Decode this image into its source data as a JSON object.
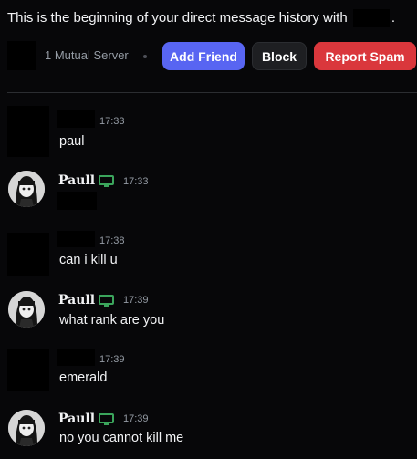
{
  "intro": {
    "text": "This is the beginning of your direct message history with",
    "suffix": "."
  },
  "actions": {
    "mutual_servers": "1 Mutual Server",
    "add_friend": "Add Friend",
    "block": "Block",
    "report_spam": "Report Spam"
  },
  "colors": {
    "accent": "#5865f2",
    "danger": "#da373c",
    "online": "#3ba55c",
    "background": "#070709"
  },
  "messages": [
    {
      "author": "",
      "time": "17:33",
      "content": "paul"
    },
    {
      "author": "Paull",
      "time": "17:33",
      "content": ""
    },
    {
      "author": "",
      "time": "17:38",
      "content": "can i kill u"
    },
    {
      "author": "Paull",
      "time": "17:39",
      "content": "what rank are you"
    },
    {
      "author": "",
      "time": "17:39",
      "content": "emerald"
    },
    {
      "author": "Paull",
      "time": "17:39",
      "content": "no you cannot kill me"
    }
  ],
  "icons": {
    "status": "desktop-icon"
  }
}
